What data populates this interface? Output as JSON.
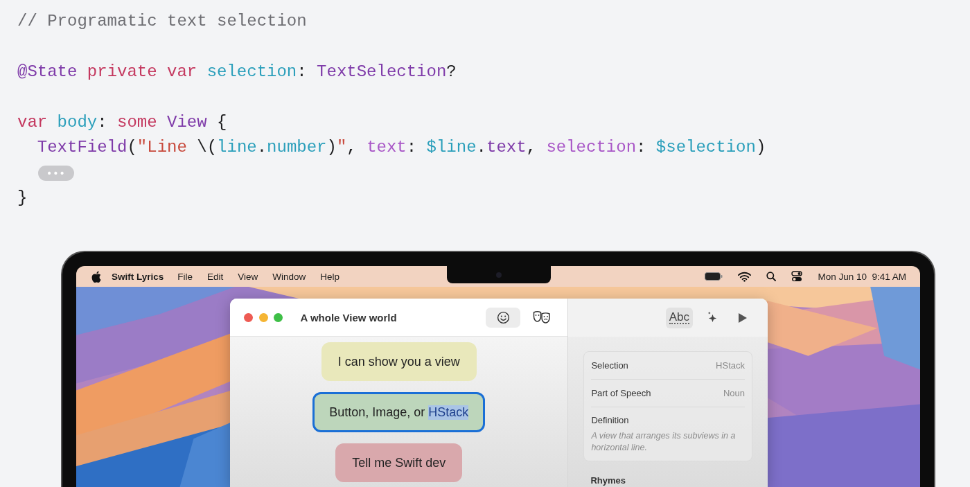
{
  "code": {
    "lines": [
      {
        "kind": "code",
        "tokens": [
          {
            "kind": "comment",
            "text": "// Programatic text selection"
          }
        ]
      },
      {
        "kind": "blank"
      },
      {
        "kind": "code",
        "tokens": [
          {
            "kind": "type",
            "text": "@State"
          },
          {
            "kind": "keyword",
            "text": " private"
          },
          {
            "kind": "keyword",
            "text": " var"
          },
          {
            "kind": "ident",
            "text": " selection"
          },
          {
            "kind": "plain",
            "text": ": "
          },
          {
            "kind": "type",
            "text": "TextSelection"
          },
          {
            "kind": "plain",
            "text": "?"
          }
        ]
      },
      {
        "kind": "blank"
      },
      {
        "kind": "code",
        "tokens": [
          {
            "kind": "keyword",
            "text": "var"
          },
          {
            "kind": "ident",
            "text": " body"
          },
          {
            "kind": "plain",
            "text": ": "
          },
          {
            "kind": "keyword",
            "text": "some"
          },
          {
            "kind": "type",
            "text": " View"
          },
          {
            "kind": "plain",
            "text": " {"
          }
        ]
      },
      {
        "kind": "code",
        "tokens": [
          {
            "kind": "type",
            "text": "  TextField"
          },
          {
            "kind": "plain",
            "text": "("
          },
          {
            "kind": "string",
            "text": "\"Line "
          },
          {
            "kind": "plain",
            "text": "\\("
          },
          {
            "kind": "ident",
            "text": "line"
          },
          {
            "kind": "plain",
            "text": "."
          },
          {
            "kind": "ident",
            "text": "number"
          },
          {
            "kind": "plain",
            "text": ")"
          },
          {
            "kind": "string",
            "text": "\""
          },
          {
            "kind": "plain",
            "text": ", "
          },
          {
            "kind": "param",
            "text": "text"
          },
          {
            "kind": "plain",
            "text": ": "
          },
          {
            "kind": "ident",
            "text": "$line"
          },
          {
            "kind": "plain",
            "text": "."
          },
          {
            "kind": "type",
            "text": "text"
          },
          {
            "kind": "plain",
            "text": ", "
          },
          {
            "kind": "param",
            "text": "selection"
          },
          {
            "kind": "plain",
            "text": ": "
          },
          {
            "kind": "ident",
            "text": "$selection"
          },
          {
            "kind": "plain",
            "text": ")"
          }
        ]
      },
      {
        "kind": "fold",
        "label": "•••"
      },
      {
        "kind": "code",
        "tokens": [
          {
            "kind": "plain",
            "text": "}"
          }
        ]
      }
    ]
  },
  "laptop": {
    "menu_bar": {
      "app_name": "Swift Lyrics",
      "menus": [
        "File",
        "Edit",
        "View",
        "Window",
        "Help"
      ],
      "clock": "Mon Jun 10  9:41 AM"
    },
    "window": {
      "title": "A whole View world",
      "toolbar": [
        {
          "kind": "smiley",
          "selected": true
        },
        {
          "kind": "masks",
          "selected": false
        }
      ],
      "lines": [
        {
          "color": "#e9e8bb",
          "focused": false,
          "segments": [
            {
              "text": "I can show you a view",
              "selected": false
            }
          ]
        },
        {
          "color": "#bdd6bb",
          "focused": true,
          "segments": [
            {
              "text": "Button, Image, or ",
              "selected": false
            },
            {
              "text": "HStack",
              "selected": true
            }
          ]
        },
        {
          "color": "#d9a8ac",
          "focused": false,
          "segments": [
            {
              "text": "Tell me Swift dev",
              "selected": false
            }
          ]
        }
      ],
      "inspector": {
        "toolbar": [
          {
            "kind": "abc",
            "label": "Abc",
            "selected": true
          },
          {
            "kind": "sparkle",
            "selected": false
          },
          {
            "kind": "play",
            "selected": false
          }
        ],
        "fields": [
          {
            "label": "Selection",
            "value": "HStack"
          },
          {
            "label": "Part of Speech",
            "value": "Noun"
          }
        ],
        "definition": {
          "label": "Definition",
          "text": "A view that arranges its subviews in a horizontal line."
        },
        "section_title": "Rhymes"
      }
    }
  }
}
